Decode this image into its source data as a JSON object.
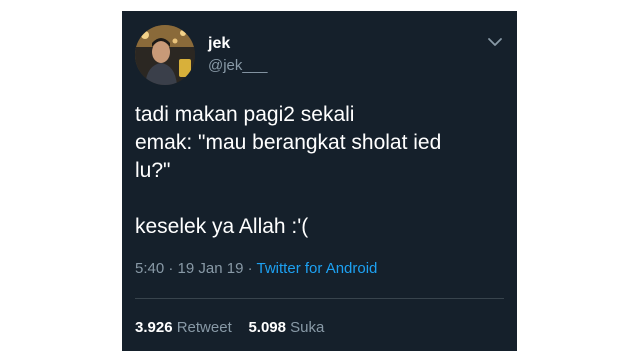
{
  "tweet": {
    "display_name": "jek",
    "handle": "@jek___",
    "text_lines": [
      "tadi makan pagi2 sekali",
      "emak: \"mau berangkat sholat ied",
      "lu?\"",
      "keselek ya Allah :'("
    ],
    "time": "5:40",
    "date": "19 Jan 19",
    "separator": "·",
    "source": "Twitter for Android",
    "retweet_count": "3.926",
    "retweet_label": "Retweet",
    "like_count": "5.098",
    "like_label": "Suka"
  },
  "icons": {
    "avatar": "user-avatar-photo",
    "menu": "chevron-down-icon"
  },
  "colors": {
    "background": "#15202b",
    "text": "#ffffff",
    "secondary_text": "#8899a6",
    "link": "#1da1f2",
    "divider": "#38444d"
  }
}
